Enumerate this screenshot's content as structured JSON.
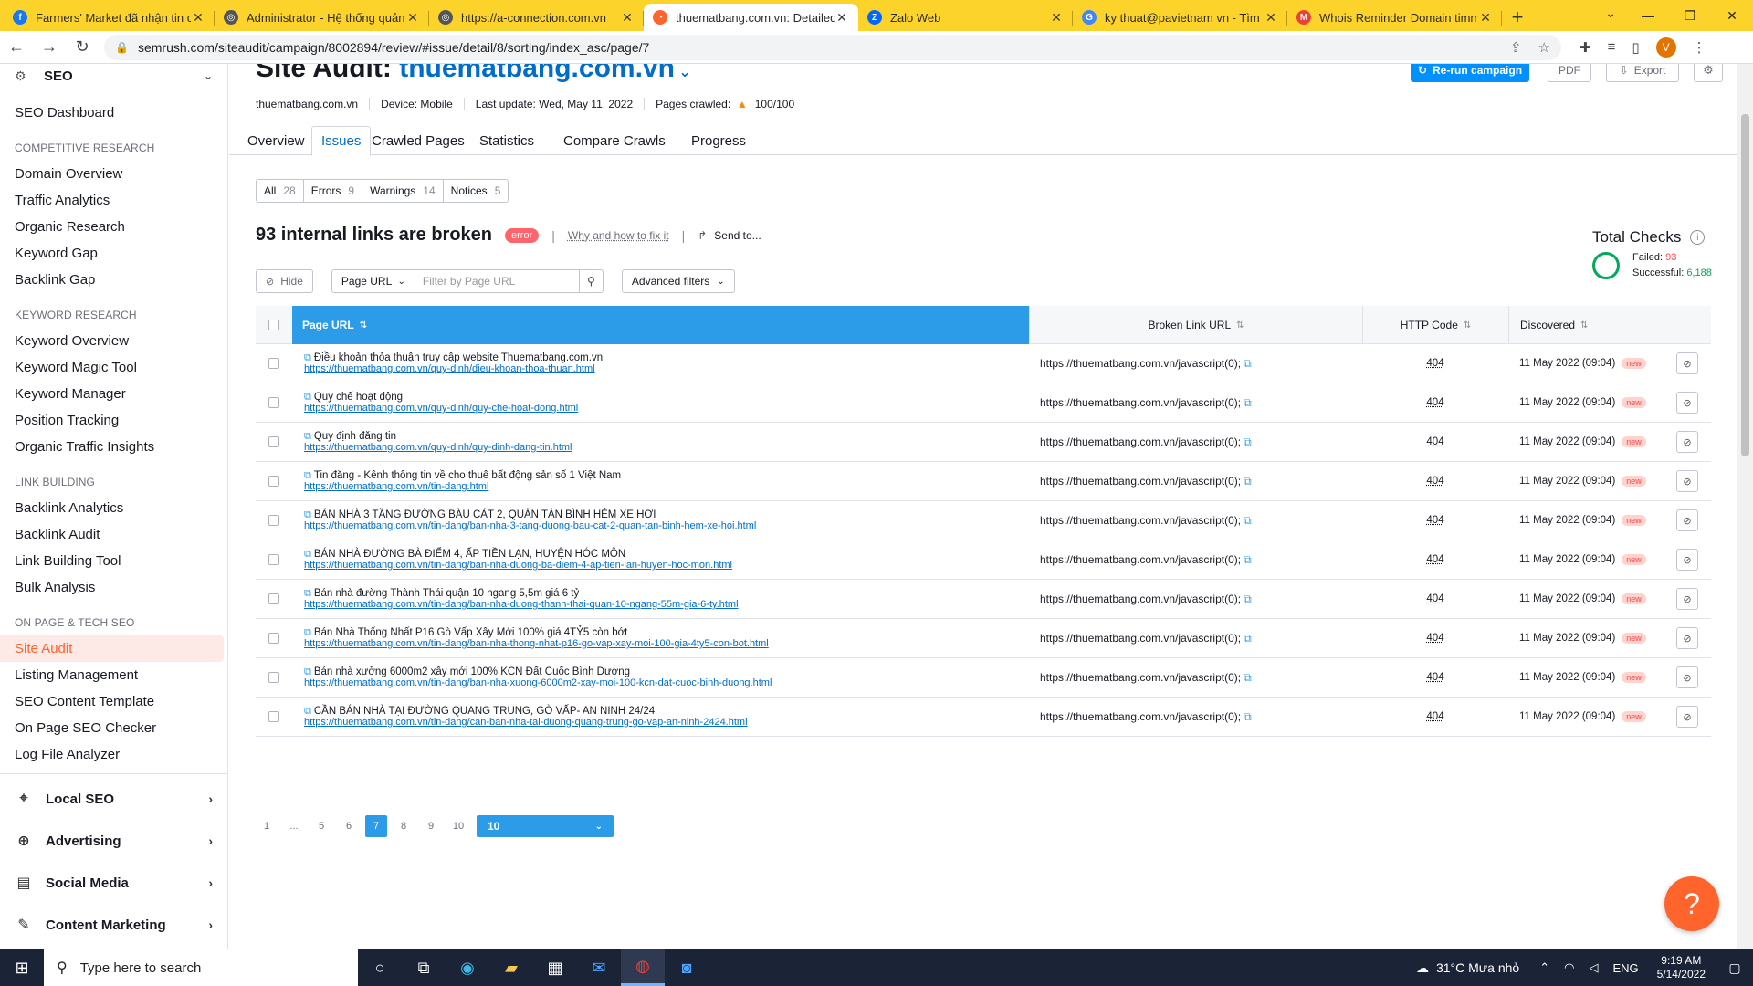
{
  "browser": {
    "tabs": [
      {
        "title": "Farmers' Market đã nhận tin chờ",
        "color": "#1877f2",
        "glyph": "f"
      },
      {
        "title": "Administrator - Hệ thống quản tr",
        "color": "#555555",
        "glyph": "◎"
      },
      {
        "title": "https://a-connection.com.vn",
        "color": "#555555",
        "glyph": "◎"
      },
      {
        "title": "thuematbang.com.vn: Detailed I",
        "color": "#ff642d",
        "glyph": "◔",
        "active": true
      },
      {
        "title": "Zalo Web",
        "color": "#0068ff",
        "glyph": "Z"
      },
      {
        "title": "ky thuat@pavietnam vn - Tìm tr",
        "color": "#4285f4",
        "glyph": "G"
      },
      {
        "title": "Whois Reminder Domain timma",
        "color": "#ea4335",
        "glyph": "M"
      }
    ],
    "url": "semrush.com/siteaudit/campaign/8002894/review/#issue/detail/8/sorting/index_asc/page/7",
    "profile_initial": "V"
  },
  "sidebar": {
    "seo_label": "SEO",
    "dashboard": "SEO Dashboard",
    "sections": [
      {
        "heading": "COMPETITIVE RESEARCH",
        "items": [
          "Domain Overview",
          "Traffic Analytics",
          "Organic Research",
          "Keyword Gap",
          "Backlink Gap"
        ]
      },
      {
        "heading": "KEYWORD RESEARCH",
        "items": [
          "Keyword Overview",
          "Keyword Magic Tool",
          "Keyword Manager",
          "Position Tracking",
          "Organic Traffic Insights"
        ]
      },
      {
        "heading": "LINK BUILDING",
        "items": [
          "Backlink Analytics",
          "Backlink Audit",
          "Link Building Tool",
          "Bulk Analysis"
        ]
      },
      {
        "heading": "ON PAGE & TECH SEO",
        "items": [
          "Site Audit",
          "Listing Management",
          "SEO Content Template",
          "On Page SEO Checker",
          "Log File Analyzer"
        ]
      }
    ],
    "active_item": "Site Audit",
    "groups": [
      {
        "label": "Local SEO",
        "icon": "location-pin-icon",
        "glyph": "⌖"
      },
      {
        "label": "Advertising",
        "icon": "target-icon",
        "glyph": "⊕"
      },
      {
        "label": "Social Media",
        "icon": "social-media-icon",
        "glyph": "▤"
      },
      {
        "label": "Content Marketing",
        "icon": "pen-icon",
        "glyph": "✎"
      }
    ]
  },
  "header": {
    "title_prefix": "Site Audit: ",
    "title_domain": "thuematbang.com.vn",
    "rerun_label": "Re-run campaign",
    "pdf_label": "PDF",
    "export_label": "Export",
    "meta": {
      "domain": "thuematbang.com.vn",
      "device": "Device: Mobile",
      "last_update": "Last update: Wed, May 11, 2022",
      "pages_label": "Pages crawled:",
      "pages_value": "100/100"
    },
    "tabs": [
      "Overview",
      "Issues",
      "Crawled Pages",
      "Statistics",
      "Compare Crawls",
      "Progress"
    ],
    "active_tab": "Issues"
  },
  "filters": [
    {
      "label": "All",
      "count": "28"
    },
    {
      "label": "Errors",
      "count": "9"
    },
    {
      "label": "Warnings",
      "count": "14"
    },
    {
      "label": "Notices",
      "count": "5"
    }
  ],
  "issue": {
    "title": "93 internal links are broken",
    "badge": "error",
    "why_link": "Why and how to fix it",
    "send_to": "Send to..."
  },
  "total_checks": {
    "title": "Total Checks",
    "failed_label": "Failed:",
    "failed_value": "93",
    "successful_label": "Successful:",
    "successful_value": "6,188"
  },
  "toolbar": {
    "hide_label": "Hide",
    "search_field": "Page URL",
    "search_placeholder": "Filter by Page URL",
    "advanced_label": "Advanced filters"
  },
  "table": {
    "columns": {
      "page_url": "Page URL",
      "broken_link": "Broken Link URL",
      "http_code": "HTTP Code",
      "discovered": "Discovered"
    },
    "rows": [
      {
        "title": "Điều khoản thỏa thuận truy cập website Thuematbang.com.vn",
        "url": "https://thuematbang.com.vn/quy-dinh/dieu-khoan-thoa-thuan.html",
        "broken": "https://thuematbang.com.vn/javascript(0);",
        "code": "404",
        "date": "11 May 2022 (09:04)",
        "badge": "new"
      },
      {
        "title": "Quy chế hoạt động",
        "url": "https://thuematbang.com.vn/quy-dinh/quy-che-hoat-dong.html",
        "broken": "https://thuematbang.com.vn/javascript(0);",
        "code": "404",
        "date": "11 May 2022 (09:04)",
        "badge": "new"
      },
      {
        "title": "Quy định đăng tin",
        "url": "https://thuematbang.com.vn/quy-dinh/quy-dinh-dang-tin.html",
        "broken": "https://thuematbang.com.vn/javascript(0);",
        "code": "404",
        "date": "11 May 2022 (09:04)",
        "badge": "new"
      },
      {
        "title": "Tin đăng - Kênh thông tin về cho thuê bất động sản số 1 Việt Nam",
        "url": "https://thuematbang.com.vn/tin-dang.html",
        "broken": "https://thuematbang.com.vn/javascript(0);",
        "code": "404",
        "date": "11 May 2022 (09:04)",
        "badge": "new"
      },
      {
        "title": "BÁN NHÀ 3 TẦNG ĐƯỜNG BÀU CÁT 2, QUẬN TÂN BÌNH HẺM XE HƠI",
        "url": "https://thuematbang.com.vn/tin-dang/ban-nha-3-tang-duong-bau-cat-2-quan-tan-binh-hem-xe-hoi.html",
        "broken": "https://thuematbang.com.vn/javascript(0);",
        "code": "404",
        "date": "11 May 2022 (09:04)",
        "badge": "new"
      },
      {
        "title": "BÁN NHÀ ĐƯỜNG BÀ ĐIỂM 4, ẤP TIỀN LẠN, HUYỆN HÓC MÔN",
        "url": "https://thuematbang.com.vn/tin-dang/ban-nha-duong-ba-diem-4-ap-tien-lan-huyen-hoc-mon.html",
        "broken": "https://thuematbang.com.vn/javascript(0);",
        "code": "404",
        "date": "11 May 2022 (09:04)",
        "badge": "new"
      },
      {
        "title": "Bán nhà đường Thành Thái quận 10 ngang 5,5m giá 6 tỷ",
        "url": "https://thuematbang.com.vn/tin-dang/ban-nha-duong-thanh-thai-quan-10-ngang-55m-gia-6-ty.html",
        "broken": "https://thuematbang.com.vn/javascript(0);",
        "code": "404",
        "date": "11 May 2022 (09:04)",
        "badge": "new"
      },
      {
        "title": "Bán Nhà Thống Nhất P16 Gò Vấp Xây Mới 100% giá 4TỶ5 còn bớt",
        "url": "https://thuematbang.com.vn/tin-dang/ban-nha-thong-nhat-p16-go-vap-xay-moi-100-gia-4ty5-con-bot.html",
        "broken": "https://thuematbang.com.vn/javascript(0);",
        "code": "404",
        "date": "11 May 2022 (09:04)",
        "badge": "new"
      },
      {
        "title": "Bán nhà xưởng 6000m2 xây mới 100% KCN Đất Cuốc Bình Dương",
        "url": "https://thuematbang.com.vn/tin-dang/ban-nha-xuong-6000m2-xay-moi-100-kcn-dat-cuoc-binh-duong.html",
        "broken": "https://thuematbang.com.vn/javascript(0);",
        "code": "404",
        "date": "11 May 2022 (09:04)",
        "badge": "new"
      },
      {
        "title": "CẦN BÁN NHÀ TẠI ĐƯỜNG QUANG TRUNG, GÒ VẤP- AN NINH 24/24",
        "url": "https://thuematbang.com.vn/tin-dang/can-ban-nha-tai-duong-quang-trung-go-vap-an-ninh-2424.html",
        "broken": "https://thuematbang.com.vn/javascript(0);",
        "code": "404",
        "date": "11 May 2022 (09:04)",
        "badge": "new"
      }
    ]
  },
  "pagination": {
    "pages": [
      "1",
      "...",
      "5",
      "6",
      "7",
      "8",
      "9",
      "10"
    ],
    "current": "7",
    "page_size": "10"
  },
  "taskbar": {
    "search_placeholder": "Type here to search",
    "weather": "31°C  Mưa nhỏ",
    "lang": "ENG",
    "time": "9:19 AM",
    "date": "5/14/2022"
  }
}
